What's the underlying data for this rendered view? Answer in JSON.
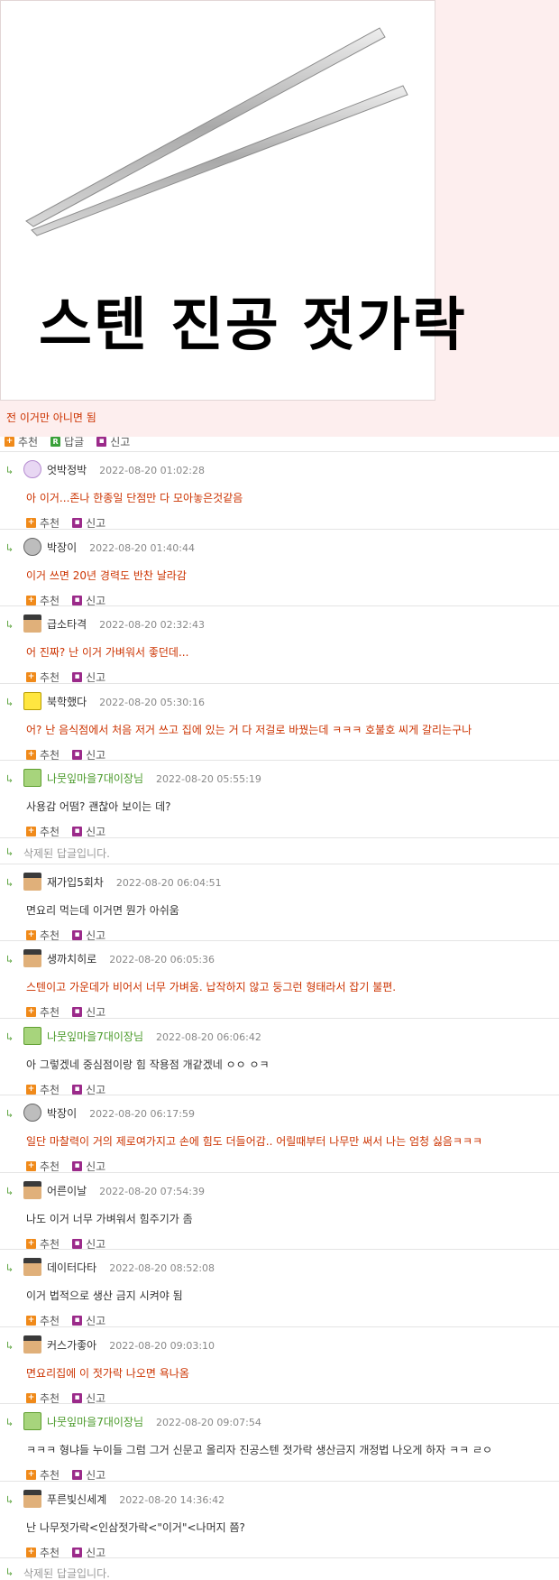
{
  "post": {
    "image_caption": "스텐 진공 젓가락",
    "text": "전 이거만 아니면 됨",
    "actions": {
      "recommend": "추천",
      "reply": "답글",
      "report": "신고"
    }
  },
  "colors": {
    "post_bg": "#fdeeee",
    "highlight_text": "#cc3300",
    "manager_name": "#4a9a2a"
  },
  "comment_actions": {
    "recommend": "추천",
    "report": "신고"
  },
  "comments": [
    {
      "type": "normal",
      "avatar": "purple-avatar",
      "nick": "엇박정박",
      "date": "2022-08-20 01:02:28",
      "text": "아 이거...존나 한종일 단점만 다 모아놓은것같음",
      "red": true
    },
    {
      "type": "normal",
      "avatar": "gray-avatar",
      "nick": "박장이",
      "date": "2022-08-20 01:40:44",
      "text": "이거 쓰면 20년 경력도 반찬 날라감",
      "red": true
    },
    {
      "type": "normal",
      "avatar": "brown-avatar",
      "nick": "급소타격",
      "date": "2022-08-20 02:32:43",
      "text": "어 진짜? 난 이거 가벼워서 좋던데...",
      "red": true
    },
    {
      "type": "normal",
      "avatar": "yellow-avatar",
      "nick": "북학했다",
      "date": "2022-08-20 05:30:16",
      "text": "어? 난 음식점에서 처음 저거 쓰고 집에 있는 거 다 저걸로 바꿨는데 ㅋㅋㅋ 호불호 씨게 갈리는구나",
      "red": true
    },
    {
      "type": "normal",
      "avatar": "green-avatar",
      "nick": "나뭇잎마을7대이장님",
      "manager": true,
      "date": "2022-08-20 05:55:19",
      "text": "사용감 어떰? 괜찮아 보이는 데?",
      "red": false
    },
    {
      "type": "deleted",
      "text": "삭제된 답글입니다."
    },
    {
      "type": "normal",
      "avatar": "brown-avatar",
      "nick": "재가입5회차",
      "date": "2022-08-20 06:04:51",
      "text": "면요리 먹는데 이거면 뭔가 아쉬움",
      "red": false
    },
    {
      "type": "normal",
      "avatar": "brown-avatar",
      "nick": "생까치히로",
      "date": "2022-08-20 06:05:36",
      "text": "스텐이고 가운데가 비어서 너무 가벼움. 납작하지 않고 둥그런 형태라서 잡기 불편.",
      "red": true
    },
    {
      "type": "normal",
      "avatar": "green-avatar",
      "nick": "나뭇잎마을7대이장님",
      "manager": true,
      "date": "2022-08-20 06:06:42",
      "text": "아 그렇겠네 중심점이랑 힘 작용점 개같겠네 ㅇㅇ ㅇㅋ",
      "red": false
    },
    {
      "type": "normal",
      "avatar": "gray-avatar",
      "nick": "박장이",
      "date": "2022-08-20 06:17:59",
      "text": "일단 마찰력이 거의 제로여가지고 손에 힘도 더들어감.. 어릴때부터 나무만 써서 나는 엄청 싫음ㅋㅋㅋ",
      "red": true
    },
    {
      "type": "normal",
      "avatar": "brown-avatar",
      "nick": "어른이날",
      "date": "2022-08-20 07:54:39",
      "text": "나도 이거 너무 가벼워서 힘주기가 좀",
      "red": false
    },
    {
      "type": "normal",
      "avatar": "brown-avatar",
      "nick": "데이터다타",
      "date": "2022-08-20 08:52:08",
      "text": "이거 법적으로 생산 금지 시켜야 됨",
      "red": false
    },
    {
      "type": "normal",
      "avatar": "brown-avatar",
      "nick": "커스가좋아",
      "date": "2022-08-20 09:03:10",
      "text": "면요리집에 이 젓가락 나오면 욕나옴",
      "red": true
    },
    {
      "type": "normal",
      "avatar": "green-avatar",
      "nick": "나뭇잎마을7대이장님",
      "manager": true,
      "date": "2022-08-20 09:07:54",
      "text": "ㅋㅋㅋ 형냐들 누이들 그럼 그거 신문고 올리자 진공스텐 젓가락 생산금지 개정법 나오게 하자 ㅋㅋ ㄹㅇ",
      "red": false
    },
    {
      "type": "normal",
      "avatar": "brown-avatar",
      "nick": "푸른빛신세계",
      "date": "2022-08-20 14:36:42",
      "text": "난 나무젓가락<인삼젓가락<\"이거\"<나머지 쯤?",
      "red": false
    },
    {
      "type": "deleted",
      "text": "삭제된 답글입니다."
    }
  ]
}
